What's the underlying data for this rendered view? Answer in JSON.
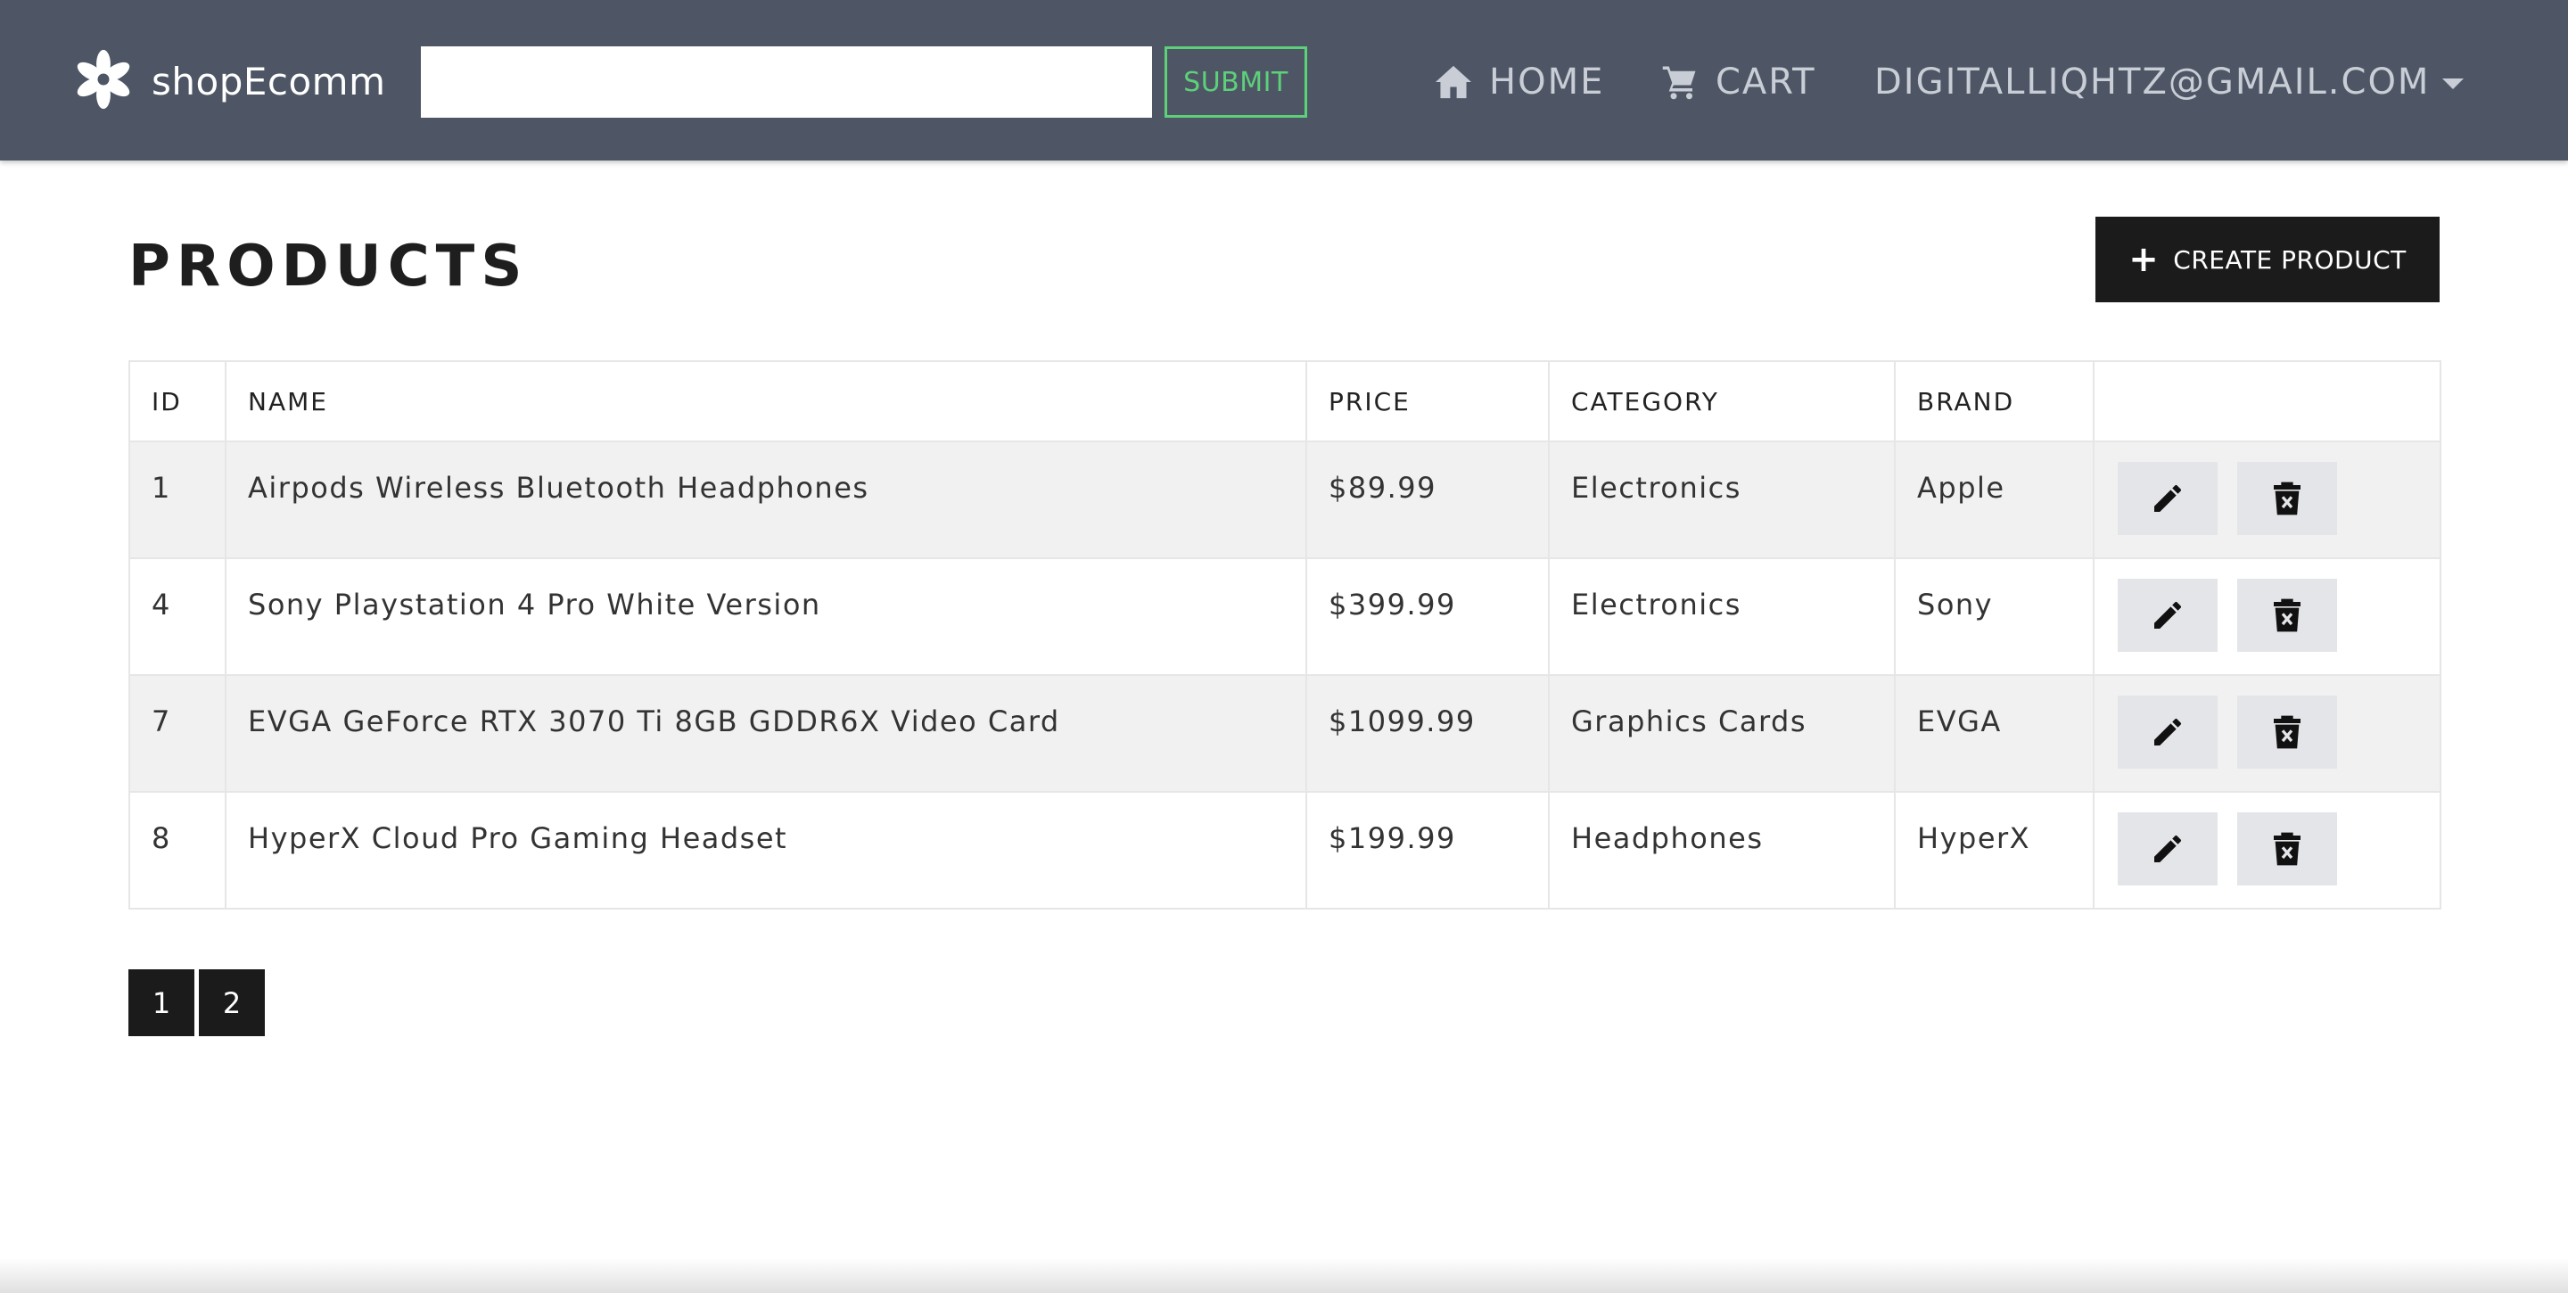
{
  "navbar": {
    "brand_name": "shopEcomm",
    "brand_icon": "flower-logo-icon",
    "search": {
      "value": "",
      "placeholder": ""
    },
    "submit_label": "SUBMIT",
    "home_label": "HOME",
    "cart_label": "CART",
    "user_label": "DIGITALLIQHTZ@GMAIL.COM"
  },
  "main": {
    "title": "PRODUCTS",
    "create_label": "CREATE PRODUCT",
    "table": {
      "headers": {
        "id": "ID",
        "name": "NAME",
        "price": "PRICE",
        "category": "CATEGORY",
        "brand": "BRAND"
      },
      "rows": [
        {
          "id": "1",
          "name": "Airpods Wireless Bluetooth Headphones",
          "price": "$89.99",
          "category": "Electronics",
          "brand": "Apple"
        },
        {
          "id": "4",
          "name": "Sony Playstation 4 Pro White Version",
          "price": "$399.99",
          "category": "Electronics",
          "brand": "Sony"
        },
        {
          "id": "7",
          "name": "EVGA GeForce RTX 3070 Ti 8GB GDDR6X Video Card",
          "price": "$1099.99",
          "category": "Graphics Cards",
          "brand": "EVGA"
        },
        {
          "id": "8",
          "name": "HyperX Cloud Pro Gaming Headset",
          "price": "$199.99",
          "category": "Headphones",
          "brand": "HyperX"
        }
      ]
    },
    "pagination": {
      "pages": [
        "1",
        "2"
      ]
    }
  },
  "colors": {
    "navbar_bg": "#4e5665",
    "submit_accent": "#5dd07a",
    "button_dark": "#1b1b1b",
    "row_shade": "#f1f1f1",
    "action_btn_bg": "#e4e5e8"
  }
}
